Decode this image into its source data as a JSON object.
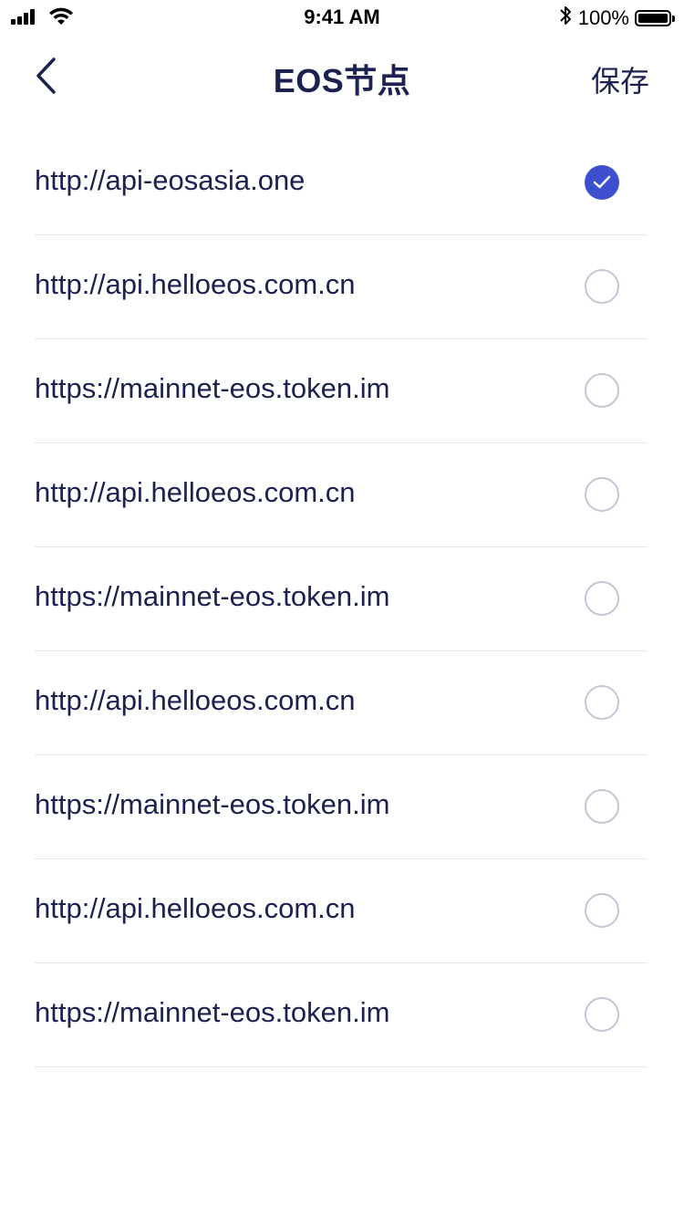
{
  "status_bar": {
    "time": "9:41 AM",
    "battery": "100%",
    "battery_level": 1.0,
    "icons": [
      "signal-icon",
      "wifi-icon",
      "bluetooth-icon",
      "battery-icon"
    ]
  },
  "header": {
    "back_icon": "chevron-left-icon",
    "title": "EOS节点",
    "save_label": "保存"
  },
  "nodes": [
    {
      "url": "http://api-eosasia.one",
      "selected": true
    },
    {
      "url": "http://api.helloeos.com.cn",
      "selected": false
    },
    {
      "url": "https://mainnet-eos.token.im",
      "selected": false
    },
    {
      "url": "http://api.helloeos.com.cn",
      "selected": false
    },
    {
      "url": "https://mainnet-eos.token.im",
      "selected": false
    },
    {
      "url": "http://api.helloeos.com.cn",
      "selected": false
    },
    {
      "url": "https://mainnet-eos.token.im",
      "selected": false
    },
    {
      "url": "http://api.helloeos.com.cn",
      "selected": false
    },
    {
      "url": "https://mainnet-eos.token.im",
      "selected": false
    }
  ],
  "colors": {
    "text": "#1c2150",
    "accent": "#3b4fcf",
    "divider": "#e6e6ee",
    "radio_border": "#c4c6d8"
  }
}
